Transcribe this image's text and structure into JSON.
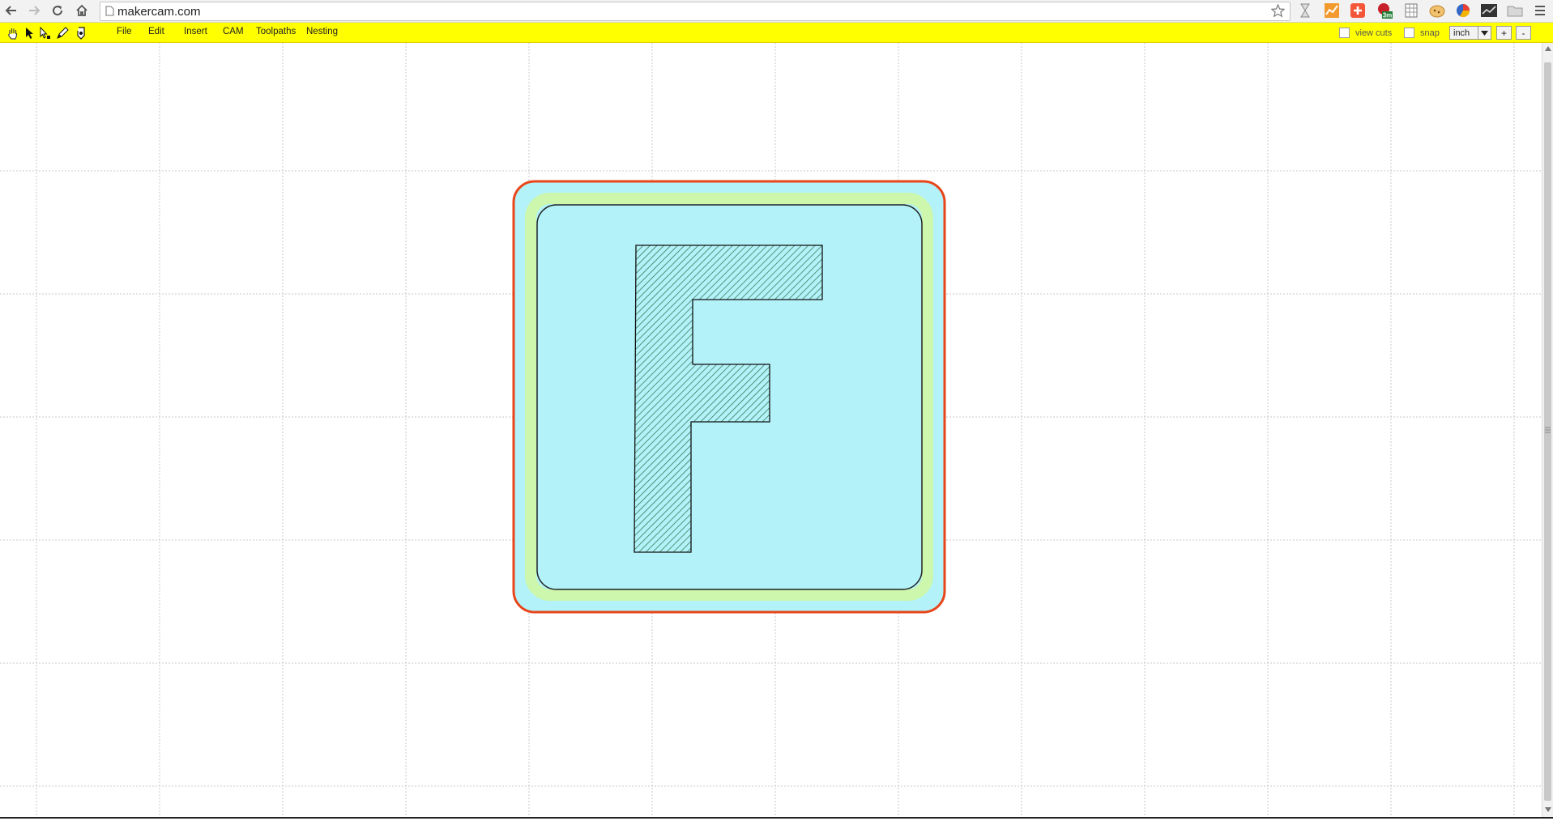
{
  "browser": {
    "url": "makercam.com",
    "nav": [
      "back-icon",
      "forward-icon",
      "reload-icon",
      "home-icon"
    ],
    "extensions": [
      "hourglass-icon",
      "chart-icon",
      "plus-icon",
      "badge-3m-icon",
      "grid-icon",
      "cookie-icon",
      "pie-icon",
      "graph-icon",
      "folder-icon",
      "menu-icon"
    ],
    "extension_badge": "3m"
  },
  "app_toolbar": {
    "background": "#ffff00",
    "tools": [
      "hand-tool-icon",
      "pointer-tool-icon",
      "node-tool-icon",
      "pen-tool-icon",
      "shape-tool-icon"
    ],
    "menus": [
      "File",
      "Edit",
      "Insert",
      "CAM",
      "Toolpaths",
      "Nesting"
    ],
    "view_cuts_label": "view cuts",
    "snap_label": "snap",
    "unit": "inch",
    "zoom_in_label": "+",
    "zoom_out_label": "-"
  },
  "canvas": {
    "grid_color": "#c8c8c8",
    "stock_color": "#b2f2f8",
    "pocket_color": "#cdf7ad",
    "outline_color": "#e8461a",
    "hatch_color": "#2a6e4a"
  }
}
